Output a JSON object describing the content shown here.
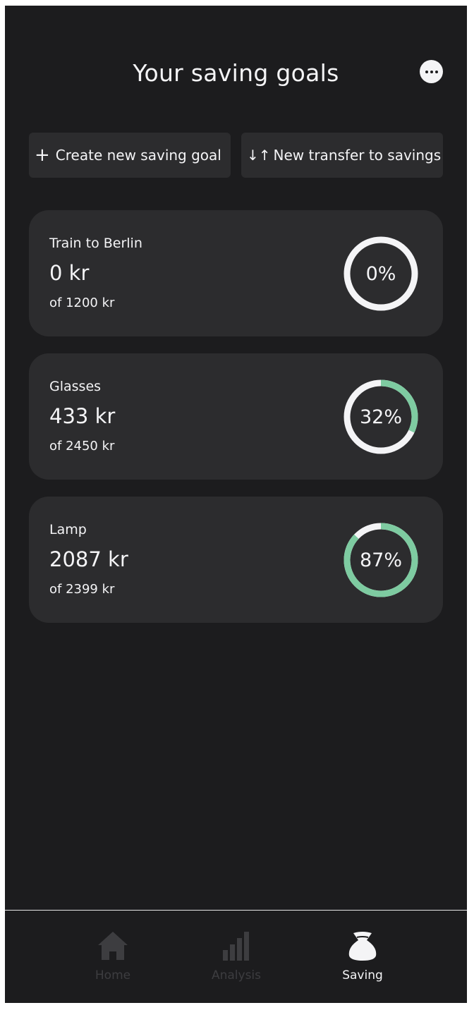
{
  "header": {
    "title": "Your saving goals",
    "more_icon": "more-horizontal-icon"
  },
  "actions": {
    "create_label": "Create new saving goal",
    "create_icon": "+",
    "transfer_label": "New transfer to savings",
    "transfer_icon": "↓↑"
  },
  "colors": {
    "accent": "#7ecba1",
    "ring_track": "#f4f4f6",
    "card": "#2c2c2e",
    "background": "#1c1c1e"
  },
  "goals": [
    {
      "name": "Train to Berlin",
      "amount": "0 kr",
      "target": "of 1200 kr",
      "percent_label": "0%",
      "progress": 0
    },
    {
      "name": "Glasses",
      "amount": "433 kr",
      "target": "of 2450 kr",
      "percent_label": "32%",
      "progress": 0.32
    },
    {
      "name": "Lamp",
      "amount": "2087 kr",
      "target": "of 2399 kr",
      "percent_label": "87%",
      "progress": 0.87
    }
  ],
  "nav": {
    "items": [
      {
        "label": "Home",
        "icon": "home-icon",
        "active": false
      },
      {
        "label": "Analysis",
        "icon": "bar-chart-icon",
        "active": false
      },
      {
        "label": "Saving",
        "icon": "money-bag-icon",
        "active": true
      }
    ]
  }
}
